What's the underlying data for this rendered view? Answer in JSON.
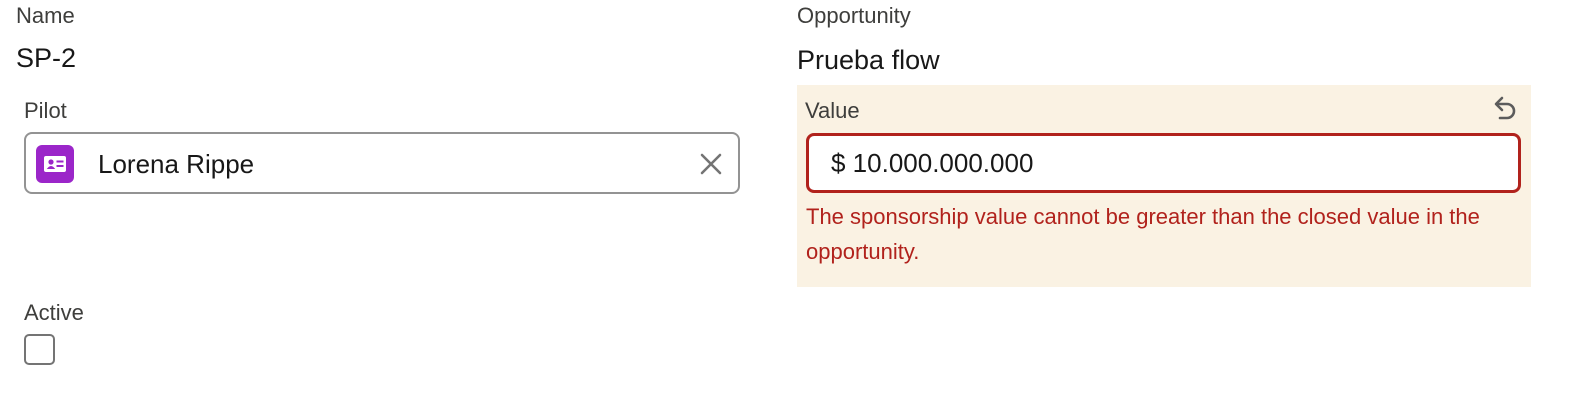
{
  "name": {
    "label": "Name",
    "value": "SP-2"
  },
  "opportunity": {
    "label": "Opportunity",
    "value": "Prueba flow"
  },
  "pilot": {
    "label": "Pilot",
    "value": "Lorena Rippe",
    "icon": "contact-card-icon",
    "icon_color": "#9b26c9",
    "clear_icon": "close-icon"
  },
  "value_field": {
    "label": "Value",
    "value": "$ 10.000.000.000",
    "error": "The sponsorship value cannot be greater than the closed value in the opportunity.",
    "undo_icon": "undo-icon",
    "error_color": "#b1221c",
    "panel_color": "#faf2e3"
  },
  "active": {
    "label": "Active",
    "checked": false
  }
}
